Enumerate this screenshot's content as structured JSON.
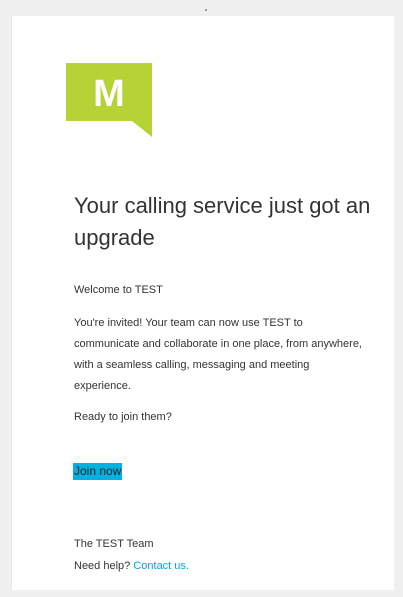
{
  "logo": {
    "letter": "M",
    "icon": "speech-bubble-logo-icon",
    "color": "#b5d334"
  },
  "email": {
    "title": "Your calling service just got an upgrade",
    "welcome": "Welcome to TEST",
    "body": "You're invited! Your team can now use TEST to communicate and collaborate in one place, from anywhere, with a seamless calling, messaging and meeting experience.",
    "ready": "Ready to join them?",
    "join_label": "Join now",
    "join_color": "#00b2e2",
    "signoff": "The TEST Team",
    "help_prefix": "Need help? ",
    "help_link": "Contact us.",
    "link_color": "#00a9e0"
  }
}
